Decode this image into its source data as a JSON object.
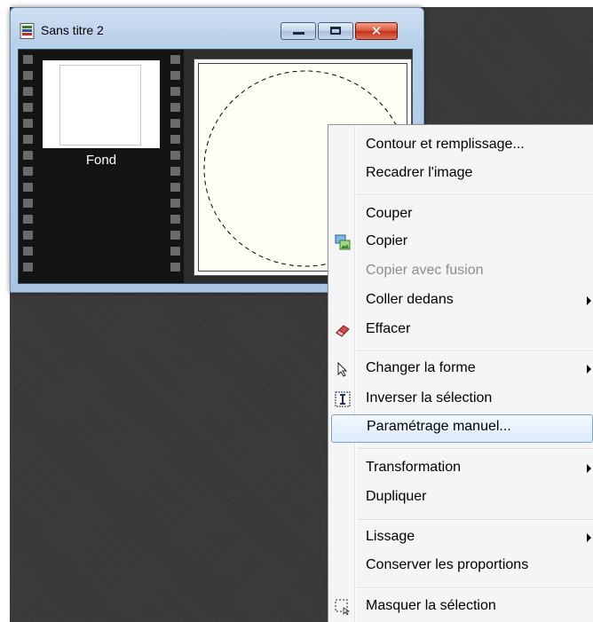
{
  "window": {
    "title": "Sans titre 2",
    "close_glyph": "✕"
  },
  "filmstrip": {
    "thumbnail_label": "Fond"
  },
  "context_menu": {
    "items": [
      {
        "label": "Contour et remplissage...",
        "enabled": true
      },
      {
        "label": "Recadrer l'image",
        "enabled": true
      },
      {
        "label": "Couper",
        "enabled": true
      },
      {
        "label": "Copier",
        "enabled": true,
        "icon": "copy-image-icon"
      },
      {
        "label": "Copier avec fusion",
        "enabled": false
      },
      {
        "label": "Coller dedans",
        "enabled": true,
        "submenu": true
      },
      {
        "label": "Effacer",
        "enabled": true,
        "icon": "eraser-icon"
      },
      {
        "label": "Changer la forme",
        "enabled": true,
        "submenu": true,
        "icon": "pointer-arrow-icon"
      },
      {
        "label": "Inverser la sélection",
        "enabled": true,
        "icon": "invert-selection-icon"
      },
      {
        "label": "Paramétrage manuel...",
        "enabled": true,
        "highlighted": true
      },
      {
        "label": "Transformation",
        "enabled": true,
        "submenu": true
      },
      {
        "label": "Dupliquer",
        "enabled": true
      },
      {
        "label": "Lissage",
        "enabled": true,
        "submenu": true
      },
      {
        "label": "Conserver les proportions",
        "enabled": true
      },
      {
        "label": "Masquer la sélection",
        "enabled": true,
        "icon": "hide-selection-icon"
      }
    ]
  },
  "colors": {
    "desktop": "#3a3a3a",
    "highlight_border": "#7da2ce",
    "disabled_text": "#8d8d8d"
  }
}
